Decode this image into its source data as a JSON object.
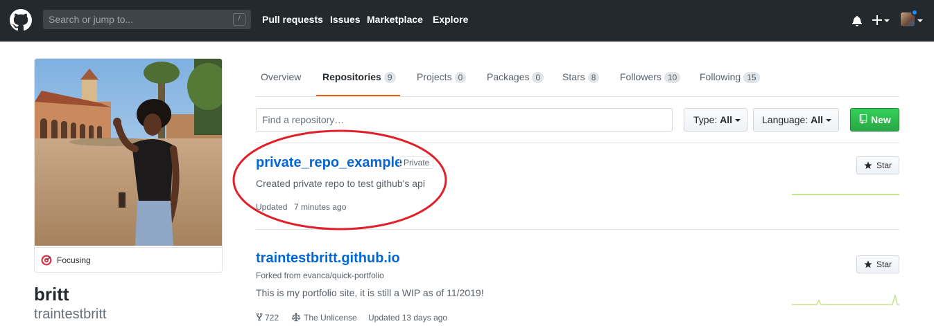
{
  "header": {
    "search_placeholder": "Search or jump to...",
    "search_key": "/",
    "nav": [
      "Pull requests",
      "Issues",
      "Marketplace",
      "Explore"
    ]
  },
  "profile": {
    "status": "Focusing",
    "full_name": "britt",
    "username": "traintestbritt"
  },
  "tabs": [
    {
      "label": "Overview",
      "count": ""
    },
    {
      "label": "Repositories",
      "count": "9"
    },
    {
      "label": "Projects",
      "count": "0"
    },
    {
      "label": "Packages",
      "count": "0"
    },
    {
      "label": "Stars",
      "count": "8"
    },
    {
      "label": "Followers",
      "count": "10"
    },
    {
      "label": "Following",
      "count": "15"
    }
  ],
  "filters": {
    "search_placeholder": "Find a repository…",
    "type_label": "Type:",
    "type_value": "All",
    "language_label": "Language:",
    "language_value": "All",
    "new_label": "New"
  },
  "repos": [
    {
      "name": "private_repo_example",
      "badge": "Private",
      "description": "Created private repo to test github's api",
      "updated_label": "Updated",
      "updated_value": "7 minutes ago",
      "star_label": "Star"
    },
    {
      "name": "traintestbritt.github.io",
      "forked_from": "Forked from evanca/quick-portfolio",
      "description": "This is my portfolio site, it is still a WIP as of 11/2019!",
      "forks": "722",
      "license": "The Unlicense",
      "updated": "Updated 13 days ago",
      "star_label": "Star"
    }
  ],
  "colors": {
    "header_bg": "#24292e",
    "link": "#0366d6",
    "tab_accent": "#e36209",
    "new_button": "#28a745",
    "annotation": "#e0202a",
    "sparkline": "#9be9a8"
  }
}
